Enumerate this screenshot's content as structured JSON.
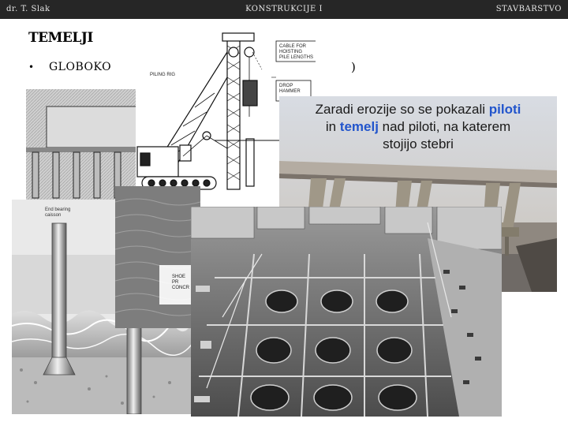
{
  "header": {
    "author": "dr. T. Slak",
    "course": "KONSTRUKCIJE I",
    "subject": "STAVBARSTVO"
  },
  "slide": {
    "title": "TEMELJI",
    "bullet_symbol": "•",
    "bullet_text": "GLOBOKO",
    "trailing_paren": ")"
  },
  "rig_diagram": {
    "label_piling_rig": "PILING RIG",
    "label_cable_line1": "CABLE FOR HOISTING",
    "label_cable_line2": "PILE LENGTHS",
    "label_drop_line1": "DROP",
    "label_drop_line2": "HAMMER"
  },
  "caisson_diagram": {
    "label_line1": "End bearing",
    "label_line2": "caisson"
  },
  "shoe_labels": {
    "line1": "SHOE",
    "line2": "PR",
    "line3": "CONCR"
  },
  "bridge_caption": {
    "text_before_1": "Zaradi erozije so se pokazali ",
    "highlight_1": "piloti",
    "text_before_2": "in ",
    "highlight_2": "temelj",
    "text_after_2": " nad piloti, na katerem",
    "line3": "stojijo stebri",
    "highlight_color": "#2255cc"
  }
}
